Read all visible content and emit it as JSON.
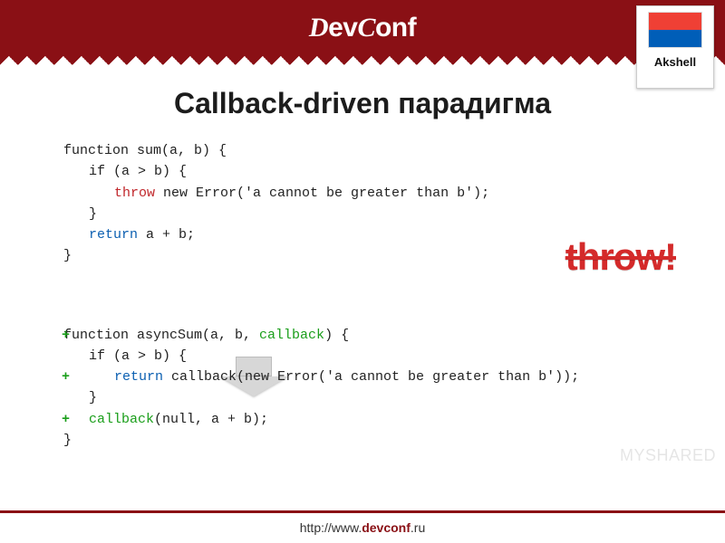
{
  "header": {
    "brand": "DevConf"
  },
  "logo": {
    "label": "Akshell"
  },
  "title": "Callback-driven парадигма",
  "callout": "throw!",
  "code1": {
    "l1": "function sum(a, b) {",
    "l2": "if (a > b) {",
    "l3a": "throw",
    "l3b": " new Error('a cannot be greater than b');",
    "l4": "}",
    "l5a": "return",
    "l5b": " a + b;",
    "l6": "}"
  },
  "code2": {
    "l1a": "function asyncSum(a, b, ",
    "l1b": "callback",
    "l1c": ") {",
    "l2": "if (a > b) {",
    "l3a": "return",
    "l3b": " callback(new Error('a cannot be greater than b'));",
    "l4": "}",
    "l5a": "callback",
    "l5b": "(null, a + b);",
    "l6": "}"
  },
  "plus": "+",
  "footer": {
    "prefix": "http://www.",
    "bold": "devconf",
    "suffix": ".ru"
  },
  "watermark": "MYSHARED"
}
